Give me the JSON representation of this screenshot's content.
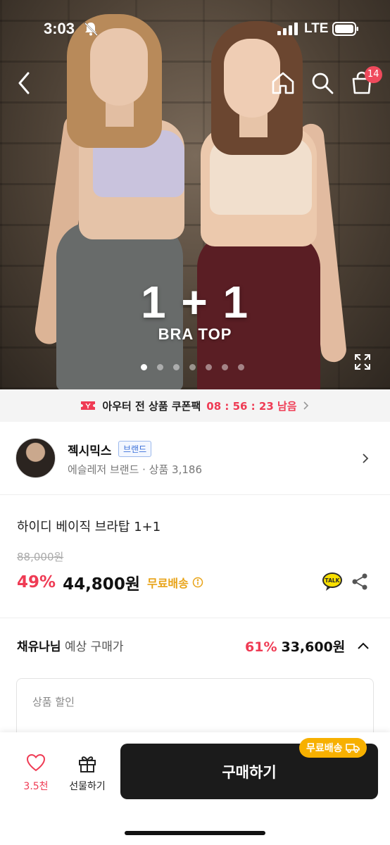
{
  "status_bar": {
    "time": "3:03",
    "network": "LTE"
  },
  "nav": {
    "cart_count": "14"
  },
  "hero": {
    "title": "1 + 1",
    "subtitle": "BRA TOP",
    "slide_count": 7,
    "active_slide": 0
  },
  "coupon": {
    "text": "아우터 전 상품 쿠폰팩",
    "timer": "08 : 56 : 23 남음"
  },
  "brand": {
    "name": "젝시믹스",
    "badge": "브랜드",
    "meta": "에슬레저 브랜드 · 상품 3,186"
  },
  "product": {
    "name": "하이디 베이직 브라탑 1+1",
    "original_price": "88,000원",
    "discount": "49%",
    "price": "44,800원",
    "shipping": "무료배송"
  },
  "expected": {
    "user": "채유나님",
    "label": " 예상 구매가",
    "rate": "61%",
    "price": "33,600원"
  },
  "detail": {
    "label": "상품 할인"
  },
  "bottom": {
    "like_count": "3.5천",
    "gift_label": "선물하기",
    "buy_label": "구매하기",
    "buy_tag": "무료배송"
  },
  "colors": {
    "accent": "#ef3b54",
    "shipping": "#e8a317",
    "buy_button": "#1b1b1b"
  }
}
